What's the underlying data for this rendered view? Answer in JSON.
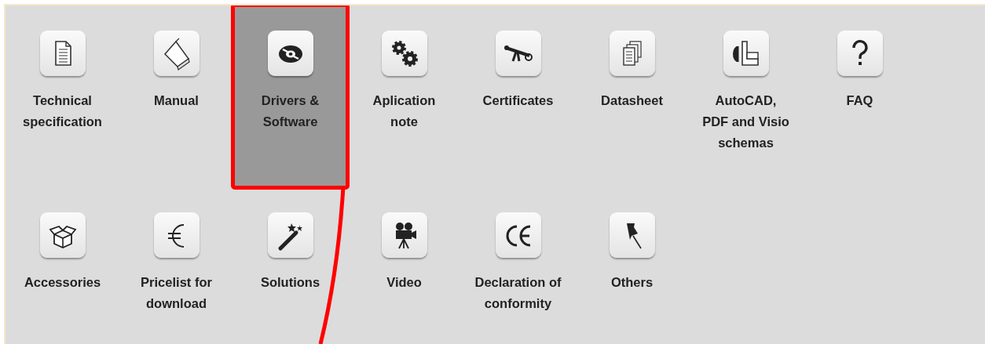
{
  "sections": [
    {
      "items": [
        {
          "label": "Technical specification",
          "selected": false
        },
        {
          "label": "Manual",
          "selected": false
        },
        {
          "label": "Drivers & Software",
          "selected": true
        },
        {
          "label": "Aplication note",
          "selected": false
        },
        {
          "label": "Certificates",
          "selected": false
        },
        {
          "label": "Datasheet",
          "selected": false
        },
        {
          "label": "AutoCAD, PDF and Visio schemas",
          "selected": false
        },
        {
          "label": "FAQ",
          "selected": false
        },
        {
          "label": "Accessories",
          "selected": false
        },
        {
          "label": "Pricelist for download",
          "selected": false
        },
        {
          "label": "Solutions",
          "selected": false
        },
        {
          "label": "Video",
          "selected": false
        },
        {
          "label": "Declaration of conformity",
          "selected": false
        },
        {
          "label": "Others",
          "selected": false
        }
      ]
    }
  ]
}
